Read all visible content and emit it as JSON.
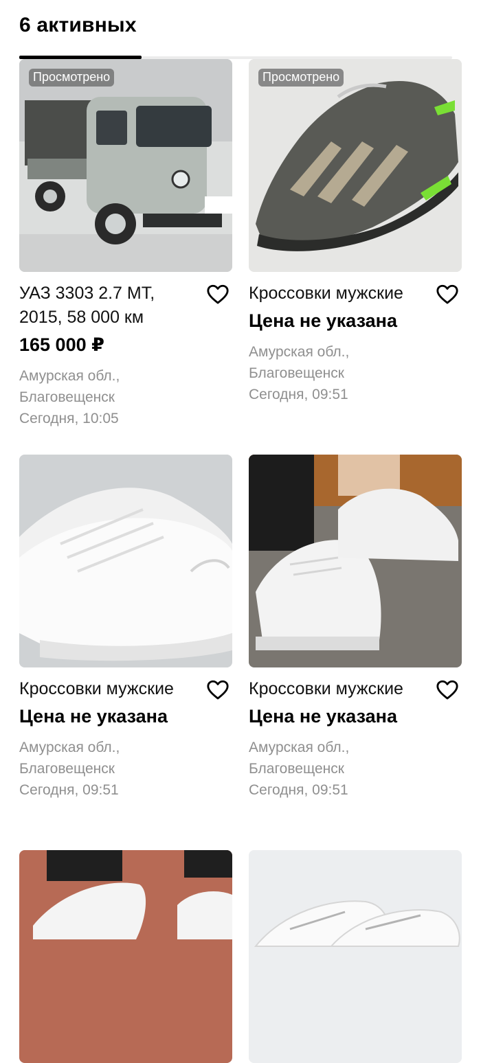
{
  "header": {
    "title": "6 активных"
  },
  "cards": [
    {
      "badge": "Просмотрено",
      "title": "УАЗ 3303 2.7 MT, 2015, 58 000 км",
      "price": "165 000 ₽",
      "location_line1": "Амурская обл.,",
      "location_line2": "Благовещенск",
      "date": "Сегодня, 10:05",
      "image": "uaz-truck-photo"
    },
    {
      "badge": "Просмотрено",
      "title": "Кроссовки мужские",
      "price": "Цена не указана",
      "location_line1": "Амурская обл.,",
      "location_line2": "Благовещенск",
      "date": "Сегодня, 09:51",
      "image": "gray-sneaker-photo"
    },
    {
      "title": "Кроссовки мужские",
      "price": "Цена не указана",
      "location_line1": "Амурская обл.,",
      "location_line2": "Благовещенск",
      "date": "Сегодня, 09:51",
      "image": "white-sneakers-photo"
    },
    {
      "title": "Кроссовки мужские",
      "price": "Цена не указана",
      "location_line1": "Амурская обл.,",
      "location_line2": "Благовещенск",
      "date": "Сегодня, 09:51",
      "image": "white-sneakers-worn-photo"
    },
    {
      "image": "white-sneakers-feet-photo"
    },
    {
      "image": "white-sneakers-pair-photo"
    }
  ],
  "icons": {
    "favorite": "heart-outline-icon"
  },
  "colors": {
    "text": "#000000",
    "muted": "#8f8f8f",
    "badge": "#6b6b6b"
  }
}
